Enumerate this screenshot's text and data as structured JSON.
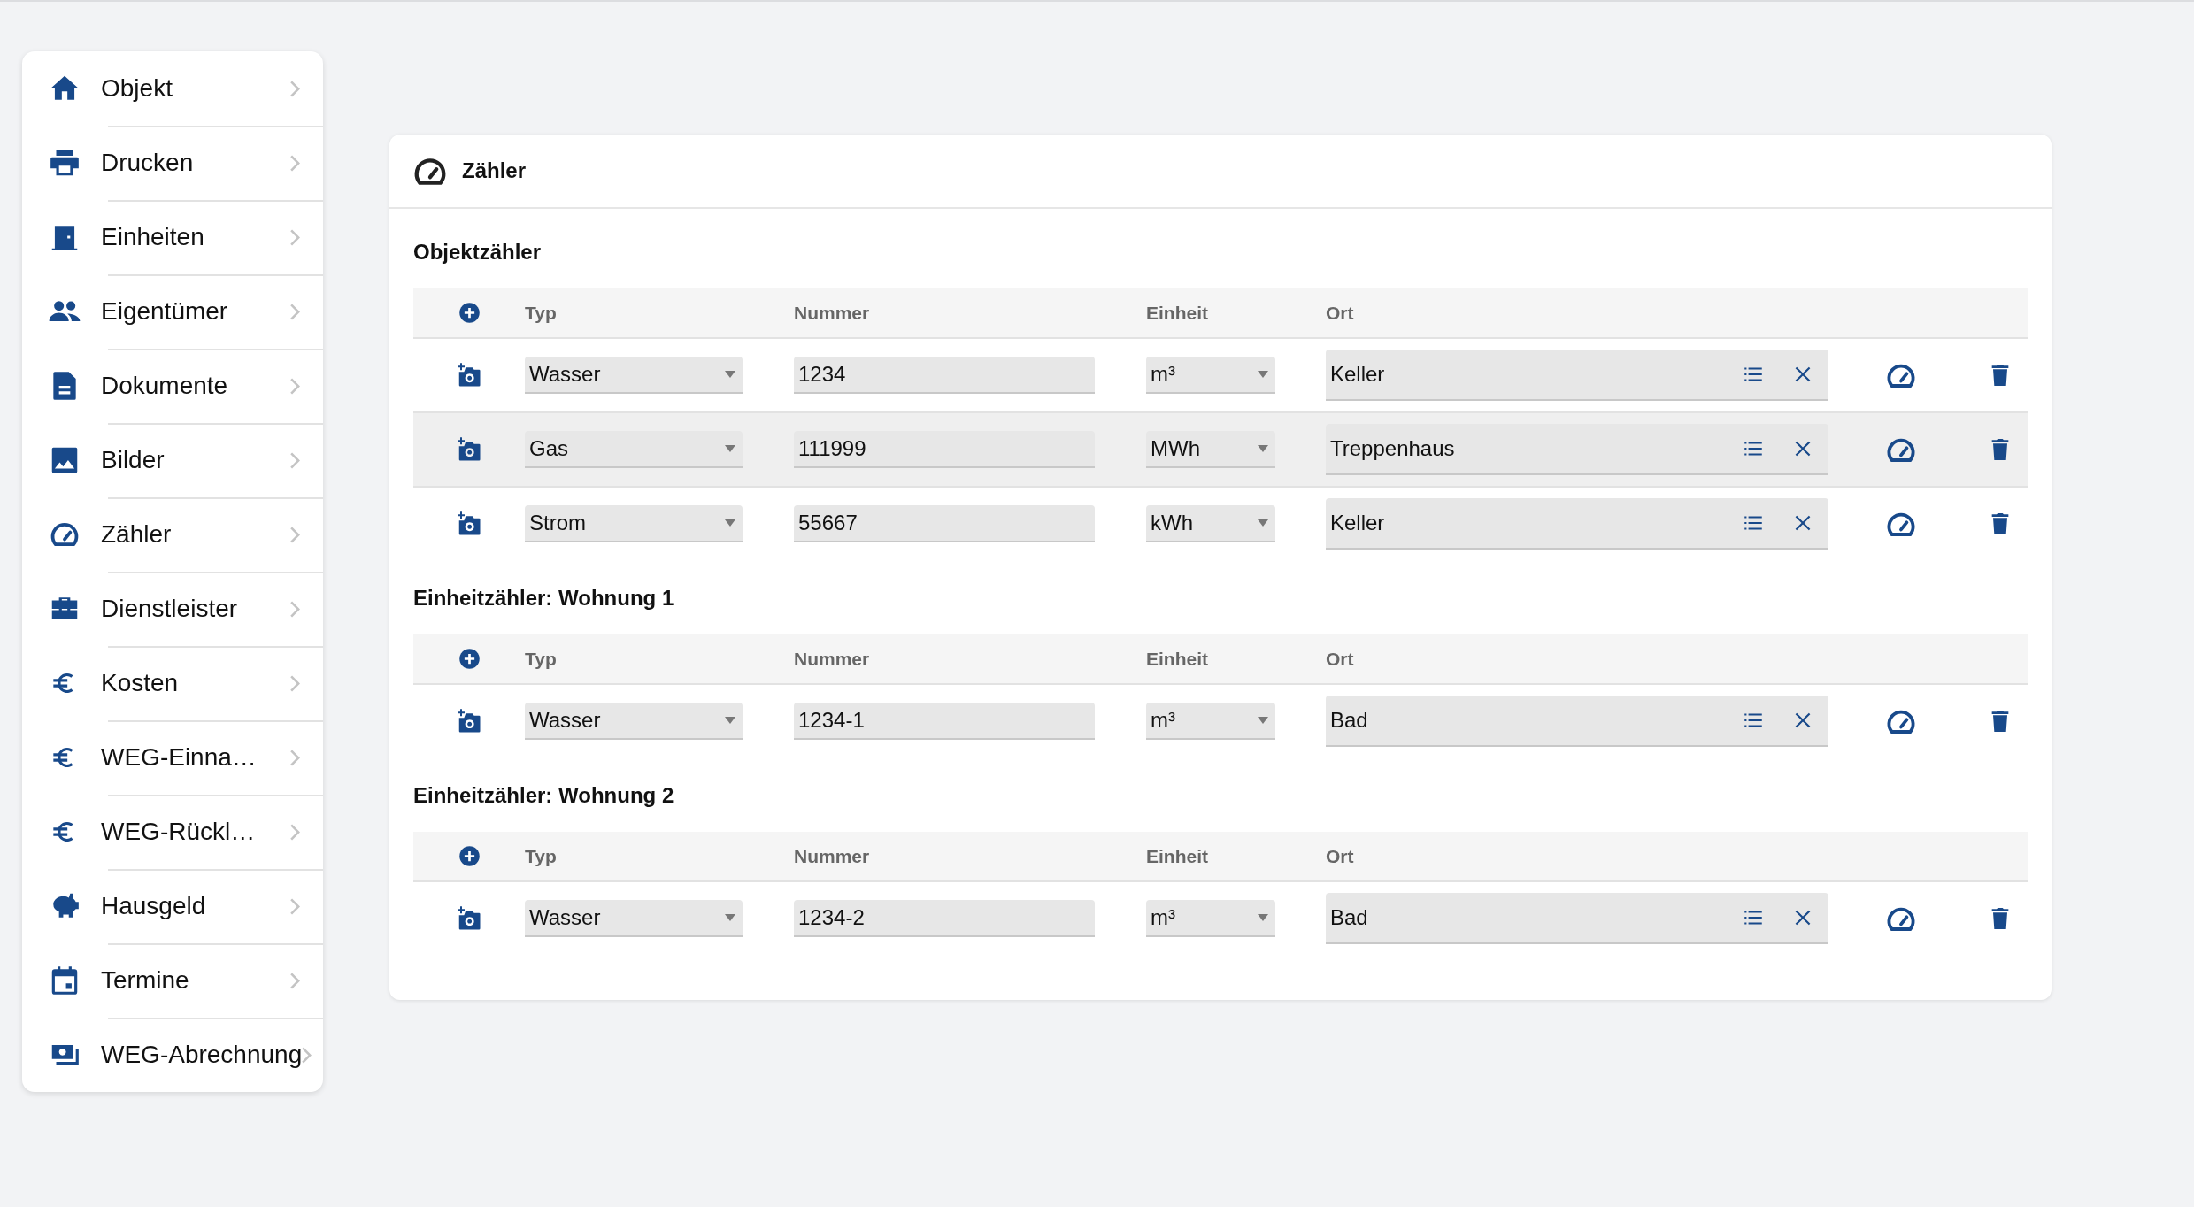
{
  "sidebar": {
    "items": [
      {
        "label": "Objekt"
      },
      {
        "label": "Drucken"
      },
      {
        "label": "Einheiten"
      },
      {
        "label": "Eigentümer"
      },
      {
        "label": "Dokumente"
      },
      {
        "label": "Bilder"
      },
      {
        "label": "Zähler"
      },
      {
        "label": "Dienstleister"
      },
      {
        "label": "Kosten"
      },
      {
        "label": "WEG-Einna…"
      },
      {
        "label": "WEG-Rückl…"
      },
      {
        "label": "Hausgeld"
      },
      {
        "label": "Termine"
      },
      {
        "label": "WEG-Abrechnung"
      }
    ]
  },
  "card": {
    "title": "Zähler",
    "sections": [
      {
        "title": "Objektzähler",
        "columns": [
          "Typ",
          "Nummer",
          "Einheit",
          "Ort"
        ],
        "rows": [
          {
            "type": "Wasser",
            "number": "1234",
            "unit": "m³",
            "location": "Keller",
            "hovered": false
          },
          {
            "type": "Gas",
            "number": "111999",
            "unit": "MWh",
            "location": "Treppenhaus",
            "hovered": true
          },
          {
            "type": "Strom",
            "number": "55667",
            "unit": "kWh",
            "location": "Keller",
            "hovered": false
          }
        ]
      },
      {
        "title": "Einheitzähler: Wohnung 1",
        "columns": [
          "Typ",
          "Nummer",
          "Einheit",
          "Ort"
        ],
        "rows": [
          {
            "type": "Wasser",
            "number": "1234-1",
            "unit": "m³",
            "location": "Bad",
            "hovered": false
          }
        ]
      },
      {
        "title": "Einheitzähler: Wohnung 2",
        "columns": [
          "Typ",
          "Nummer",
          "Einheit",
          "Ort"
        ],
        "rows": [
          {
            "type": "Wasser",
            "number": "1234-2",
            "unit": "m³",
            "location": "Bad",
            "hovered": false
          }
        ]
      }
    ]
  }
}
